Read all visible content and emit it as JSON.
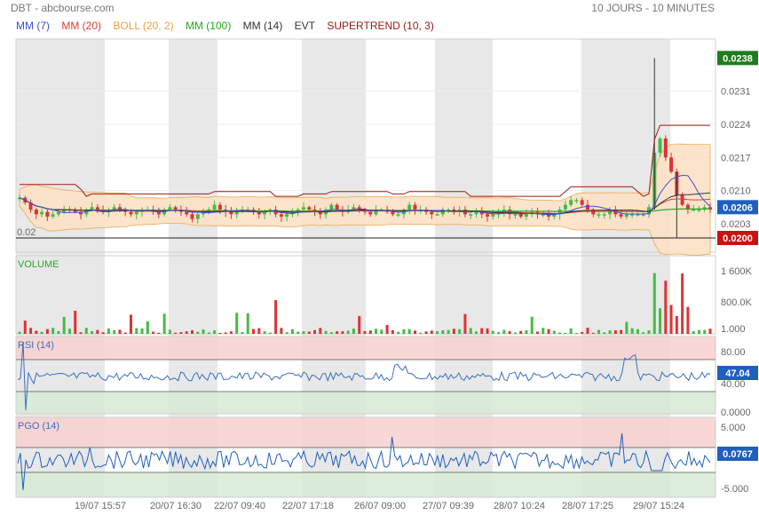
{
  "header": {
    "left": "DBT - abcbourse.com",
    "right": "10 JOURS - 10 MINUTES"
  },
  "legend": [
    {
      "label": "MM (7)",
      "color": "#3b4fd8"
    },
    {
      "label": "MM (20)",
      "color": "#e03c3c"
    },
    {
      "label": "BOLL (20, 2)",
      "color": "#f0a040"
    },
    {
      "label": "MM (100)",
      "color": "#22aa22"
    },
    {
      "label": "MM (14)",
      "color": "#333333"
    },
    {
      "label": "EVT",
      "color": "#333333"
    },
    {
      "label": "SUPERTREND (10, 3)",
      "color": "#a01818"
    }
  ],
  "colors": {
    "up": "#44bb44",
    "down": "#dd3333",
    "boll_fill": "#fbe2c6",
    "boll_line": "#f0a040",
    "mm7": "#3b4fd8",
    "mm20": "#e03c3c",
    "mm100": "#22aa22",
    "mm14": "#333333",
    "supertrend": "#a01818",
    "shade": "#e8e8e8",
    "rsi_line": "#3a6fc0",
    "pgo_line": "#1f5fbf",
    "overbought": "#f8d0d0",
    "oversold": "#d6ead6",
    "badge_last": "#1f5fbf",
    "badge_high": "#1e7d1e",
    "badge_low": "#cc1111"
  },
  "chart_data": [
    {
      "type": "line",
      "panel": "price",
      "title": "DBT",
      "x_labels": [
        "19/07 15:57",
        "20/07 16:30",
        "22/07 09:40",
        "22/07 17:18",
        "26/07 09:00",
        "27/07 09:39",
        "28/07 10:24",
        "28/07 17:25",
        "29/07 15:24"
      ],
      "y_ticks": [
        "0.0231",
        "0.0224",
        "0.0217",
        "0.0210",
        "0.0203"
      ],
      "ylim": [
        0.0197,
        0.0242
      ],
      "reference_line": {
        "value": 0.02,
        "label": "0.02"
      },
      "badges": {
        "high": "0.0238",
        "last": "0.0206",
        "low": "0.0200"
      },
      "close": [
        0.02085,
        0.02075,
        0.0206,
        0.0205,
        0.02055,
        0.02045,
        0.0205,
        0.02055,
        0.0206,
        0.0206,
        0.02055,
        0.0205,
        0.0206,
        0.02065,
        0.0206,
        0.02055,
        0.0206,
        0.02065,
        0.0206,
        0.02055,
        0.0205,
        0.02055,
        0.0206,
        0.0206,
        0.02055,
        0.0205,
        0.0206,
        0.02065,
        0.0206,
        0.02055,
        0.0205,
        0.0204,
        0.0205,
        0.02055,
        0.0206,
        0.0207,
        0.0206,
        0.02055,
        0.0205,
        0.02055,
        0.0206,
        0.0206,
        0.02055,
        0.0205,
        0.02055,
        0.0206,
        0.0205,
        0.02045,
        0.0205,
        0.02055,
        0.0206,
        0.02065,
        0.0206,
        0.02055,
        0.0205,
        0.0206,
        0.0207,
        0.0206,
        0.02055,
        0.0206,
        0.02065,
        0.0206,
        0.02055,
        0.0205,
        0.0206,
        0.0206,
        0.02055,
        0.0205,
        0.0205,
        0.0206,
        0.0207,
        0.0206,
        0.0206,
        0.02055,
        0.0205,
        0.0205,
        0.0206,
        0.0206,
        0.02055,
        0.0206,
        0.0205,
        0.0205,
        0.02055,
        0.0205,
        0.02045,
        0.0205,
        0.02055,
        0.0206,
        0.0205,
        0.0205,
        0.02045,
        0.0205,
        0.02055,
        0.0205,
        0.0205,
        0.02045,
        0.0205,
        0.0206,
        0.0207,
        0.0208,
        0.0208,
        0.0207,
        0.0206,
        0.0205,
        0.0205,
        0.0205,
        0.0206,
        0.0205,
        0.02045,
        0.0205,
        0.0205,
        0.0205,
        0.0205,
        0.02065,
        0.0218,
        0.0221,
        0.0217,
        0.0214,
        0.0209,
        0.0207,
        0.0206,
        0.0206,
        0.0206,
        0.02065,
        0.0206
      ]
    },
    {
      "type": "bar",
      "panel": "volume",
      "title": "VOLUME",
      "y_ticks": [
        "1 600K",
        "800.0K",
        "1.000"
      ],
      "ylim": [
        0,
        2000000
      ]
    },
    {
      "type": "line",
      "panel": "rsi",
      "title": "RSI (14)",
      "y_ticks": [
        "80.00",
        "40.00",
        "0.0000"
      ],
      "ylim": [
        0,
        100
      ],
      "overbought": 70,
      "oversold": 30,
      "last": "47.04"
    },
    {
      "type": "line",
      "panel": "pgo",
      "title": "PGO (14)",
      "y_ticks": [
        "5.000",
        "-5.000"
      ],
      "ylim": [
        -6,
        6
      ],
      "overbought": 3,
      "oversold": -3,
      "last": "0.0767"
    }
  ]
}
